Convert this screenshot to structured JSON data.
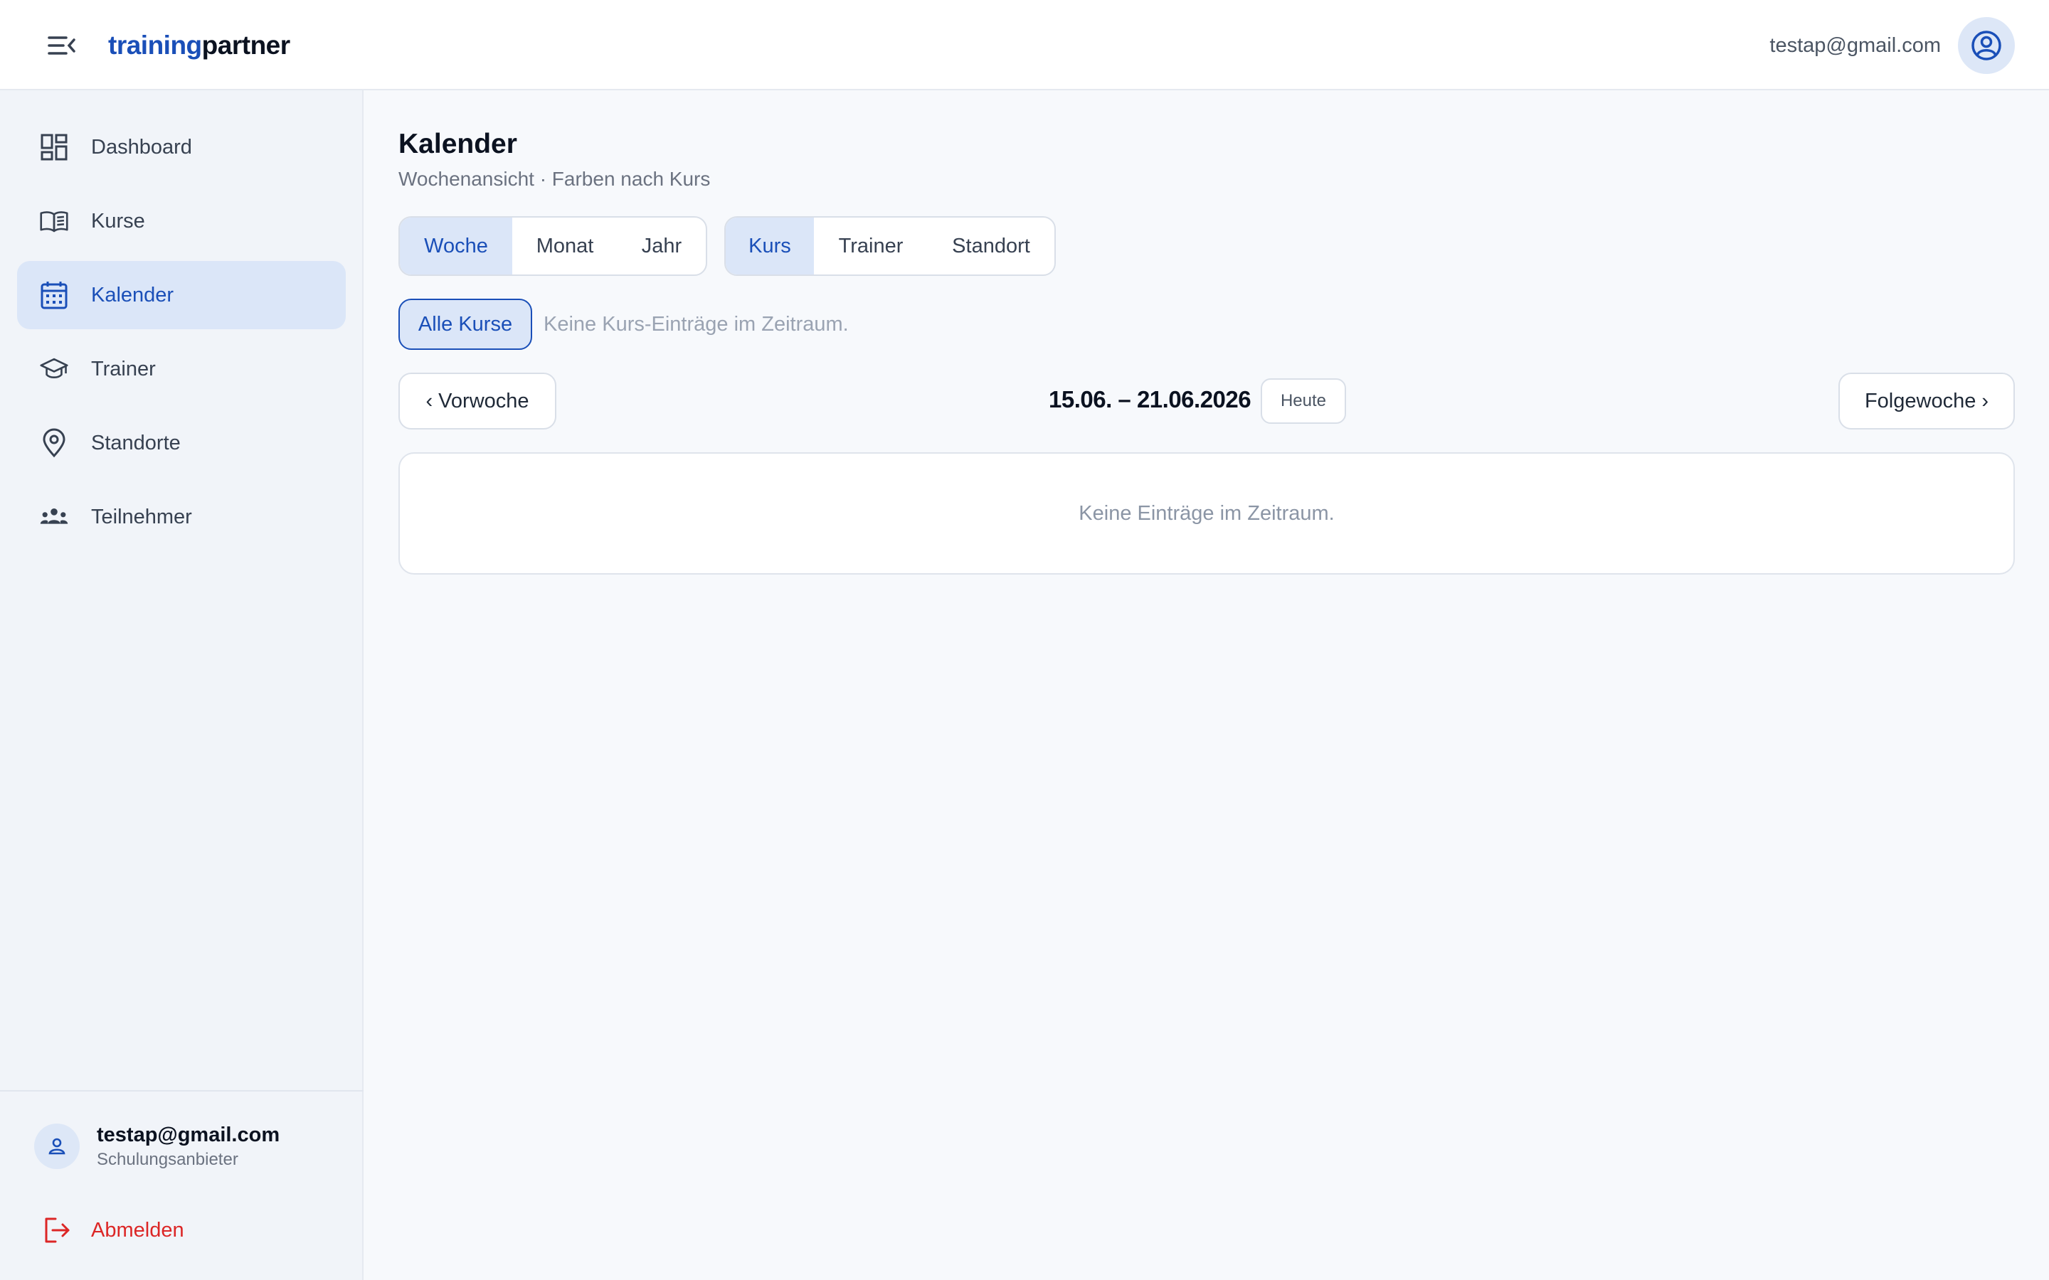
{
  "header": {
    "brand_part1": "training",
    "brand_part2": "partner",
    "user_email": "testap@gmail.com",
    "menu_icon": "menu-collapse-icon",
    "avatar_icon": "user-circle-icon"
  },
  "sidebar": {
    "items": [
      {
        "label": "Dashboard",
        "icon": "dashboard-icon",
        "active": false
      },
      {
        "label": "Kurse",
        "icon": "book-open-icon",
        "active": false
      },
      {
        "label": "Kalender",
        "icon": "calendar-icon",
        "active": true
      },
      {
        "label": "Trainer",
        "icon": "graduation-cap-icon",
        "active": false
      },
      {
        "label": "Standorte",
        "icon": "map-pin-icon",
        "active": false
      },
      {
        "label": "Teilnehmer",
        "icon": "users-icon",
        "active": false
      }
    ],
    "user": {
      "email": "testap@gmail.com",
      "role": "Schulungsanbieter"
    },
    "logout_label": "Abmelden"
  },
  "main": {
    "title": "Kalender",
    "subtitle": "Wochenansicht · Farben nach Kurs",
    "view_tabs": [
      "Woche",
      "Monat",
      "Jahr"
    ],
    "view_selected": "Woche",
    "color_tabs": [
      "Kurs",
      "Trainer",
      "Standort"
    ],
    "color_selected": "Kurs",
    "filter_chip": "Alle Kurse",
    "filter_note": "Keine Kurs-Einträge im Zeitraum.",
    "prev_label": "‹ Vorwoche",
    "next_label": "Folgewoche ›",
    "range_label": "15.06. – 21.06.2026",
    "today_label": "Heute",
    "empty_message": "Keine Einträge im Zeitraum."
  },
  "colors": {
    "accent": "#1a4fb8",
    "accent_bg": "#dbe6f8",
    "danger": "#dc2626"
  }
}
